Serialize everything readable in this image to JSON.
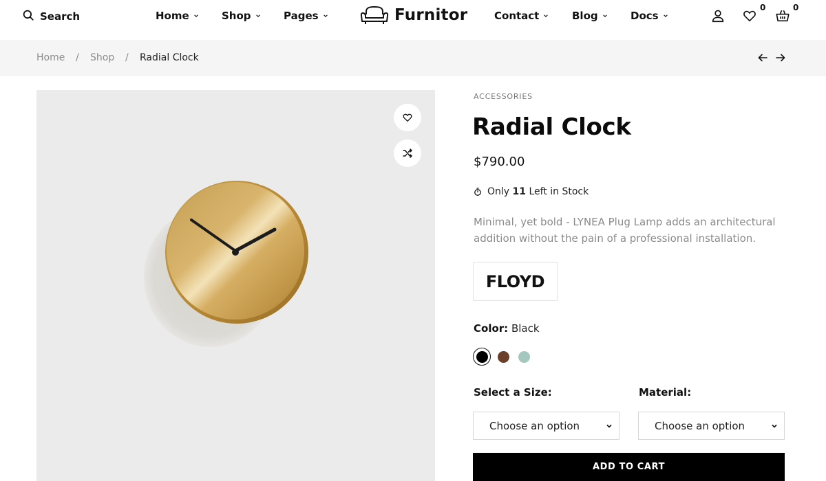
{
  "header": {
    "search_label": "Search",
    "nav_left": [
      {
        "label": "Home"
      },
      {
        "label": "Shop"
      },
      {
        "label": "Pages"
      }
    ],
    "logo_text": "Furnitor",
    "nav_right": [
      {
        "label": "Contact"
      },
      {
        "label": "Blog"
      },
      {
        "label": "Docs"
      }
    ],
    "wishlist_count": "0",
    "cart_count": "0"
  },
  "breadcrumb": {
    "items": [
      "Home",
      "Shop",
      "Radial Clock"
    ],
    "separator": "/"
  },
  "product": {
    "category": "ACCESSORIES",
    "title": "Radial Clock",
    "price": "$790.00",
    "stock_prefix": "Only",
    "stock_count": "11",
    "stock_suffix": "Left in Stock",
    "description": "Minimal, yet bold - LYNEA Plug Lamp adds an architectural addition without the pain of a professional installation.",
    "brand": "FLOYD",
    "color_label": "Color:",
    "color_value": "Black",
    "swatches": [
      {
        "name": "black",
        "hex": "#000000",
        "selected": true
      },
      {
        "name": "brown",
        "hex": "#6b3f2a",
        "selected": false
      },
      {
        "name": "sage",
        "hex": "#a4c8bd",
        "selected": false
      }
    ],
    "size_label": "Select a Size:",
    "size_value": "Choose an option",
    "material_label": "Material:",
    "material_value": "Choose an option",
    "add_to_cart": "ADD TO CART"
  },
  "icons": {
    "search": "search-icon",
    "account": "user-icon",
    "wishlist": "heart-icon",
    "cart": "basket-icon",
    "prev": "arrow-left-icon",
    "next": "arrow-right-icon",
    "add_wishlist": "heart-icon",
    "compare": "shuffle-icon",
    "stock": "stopwatch-icon"
  }
}
